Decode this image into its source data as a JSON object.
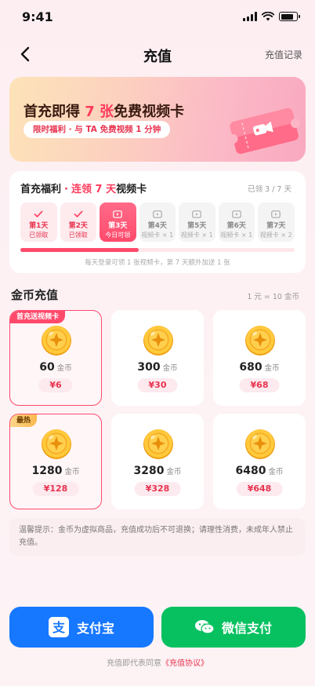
{
  "status": {
    "time": "9:41"
  },
  "nav": {
    "title": "充值",
    "record": "充值记录"
  },
  "banner": {
    "headline_pre": "首充即得 ",
    "headline_num": "7 张",
    "headline_post": "免费视频卡",
    "sub": "限时福利 · 与 TA 免费视频 1 分钟"
  },
  "signin": {
    "title_a": "首充福利",
    "title_dot": "·",
    "title_hl": "连领 7 天",
    "title_b": "视频卡",
    "claimed": "已领 3 / 7 天",
    "progress": 0.43,
    "days": [
      {
        "day": "第1天",
        "status": "已领取",
        "state": "done"
      },
      {
        "day": "第2天",
        "status": "已领取",
        "state": "done"
      },
      {
        "day": "第3天",
        "status": "今日可领",
        "state": "today"
      },
      {
        "day": "第4天",
        "status": "视频卡 × 1",
        "state": "todo"
      },
      {
        "day": "第5天",
        "status": "视频卡 × 1",
        "state": "todo"
      },
      {
        "day": "第6天",
        "status": "视频卡 × 1",
        "state": "todo"
      },
      {
        "day": "第7天",
        "status": "视频卡 × 2",
        "state": "todo"
      }
    ],
    "tip": "每天登录可领 1 张视频卡，第 7 天额外加送 1 张"
  },
  "coins": {
    "title": "金币充值",
    "rate": "1 元 = 10 金币",
    "unit": "金币",
    "packages": [
      {
        "amount": "60",
        "price": "¥6",
        "tag": "首充送视频卡",
        "selected": true
      },
      {
        "amount": "300",
        "price": "¥30"
      },
      {
        "amount": "680",
        "price": "¥68"
      },
      {
        "amount": "1280",
        "price": "¥128",
        "tag": "最热",
        "selected": true
      },
      {
        "amount": "3280",
        "price": "¥328"
      },
      {
        "amount": "6480",
        "price": "¥648"
      }
    ]
  },
  "notice": "温馨提示：金币为虚拟商品，充值成功后不可退换；请理性消费，未成年人禁止充值。",
  "pay": {
    "alipay": "支付宝",
    "wechat": "微信支付"
  },
  "agree": {
    "pre": "充值即代表同意",
    "link": "《充值协议》"
  },
  "colors": {
    "accent": "#ff4a6c",
    "alipay": "#1677ff",
    "wechat": "#07c160"
  }
}
